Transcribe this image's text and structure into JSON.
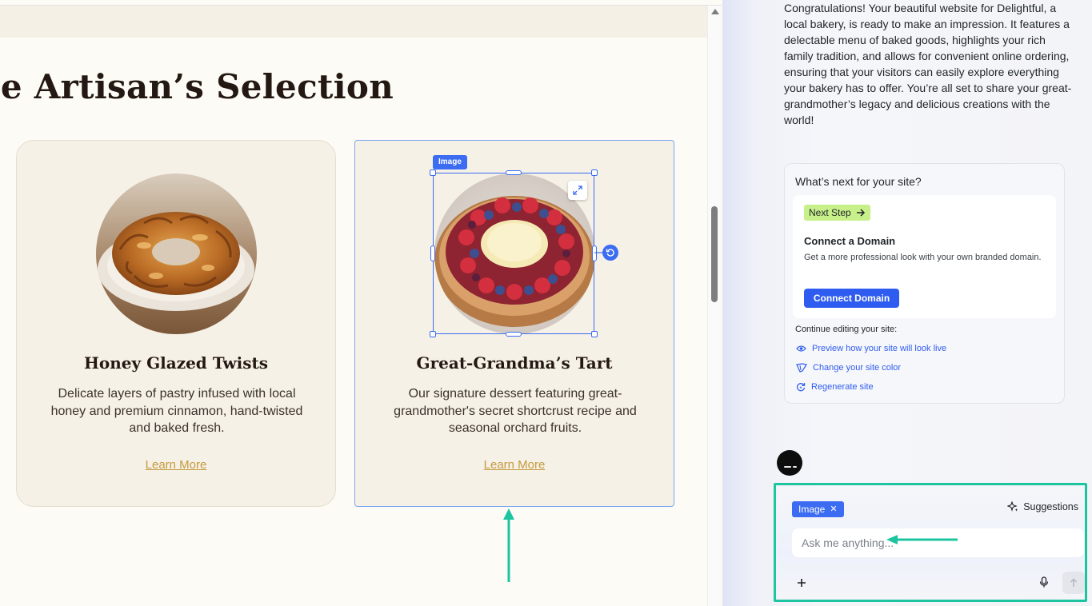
{
  "preview": {
    "heading": "he Artisan’s Selection",
    "cards": [
      {
        "title": "Honey Glazed Twists",
        "description": "Delicate layers of pastry infused with local honey and premium cinnamon, hand-twisted and baked fresh.",
        "link": "Learn More"
      },
      {
        "title": "Great-Grandma’s Tart",
        "description": "Our signature dessert featuring great-grandmother's secret shortcrust recipe and seasonal orchard fruits.",
        "link": "Learn More"
      }
    ],
    "selection_tag": "Image"
  },
  "panel": {
    "message": "Congratulations! Your beautiful website for Delightful, a local bakery, is ready to make an impression. It features a delectable menu of baked goods, highlights your rich family tradition, and allows for convenient online ordering, ensuring that your visitors can easily explore everything your bakery has to offer. You’re all set to share your great-grandmother’s legacy and delicious creations with the world!",
    "next": {
      "question": "What’s next for your site?",
      "badge": "Next Step",
      "title": "Connect a Domain",
      "description": "Get a more professional look with your own branded domain.",
      "button": "Connect Domain"
    },
    "continue_label": "Continue editing your site:",
    "actions": [
      {
        "label": "Preview how your site will look live",
        "icon": "eye-icon"
      },
      {
        "label": "Change your site color",
        "icon": "palette-icon"
      },
      {
        "label": "Regenerate site",
        "icon": "regenerate-icon"
      }
    ],
    "composer": {
      "chip": "Image",
      "suggestions": "Suggestions",
      "placeholder": "Ask me anything..."
    }
  },
  "colors": {
    "accent_blue": "#3b6cf2",
    "annotation_teal": "#1cc5a0",
    "link_gold": "#c49a3d",
    "badge_green": "#c7f08a"
  }
}
